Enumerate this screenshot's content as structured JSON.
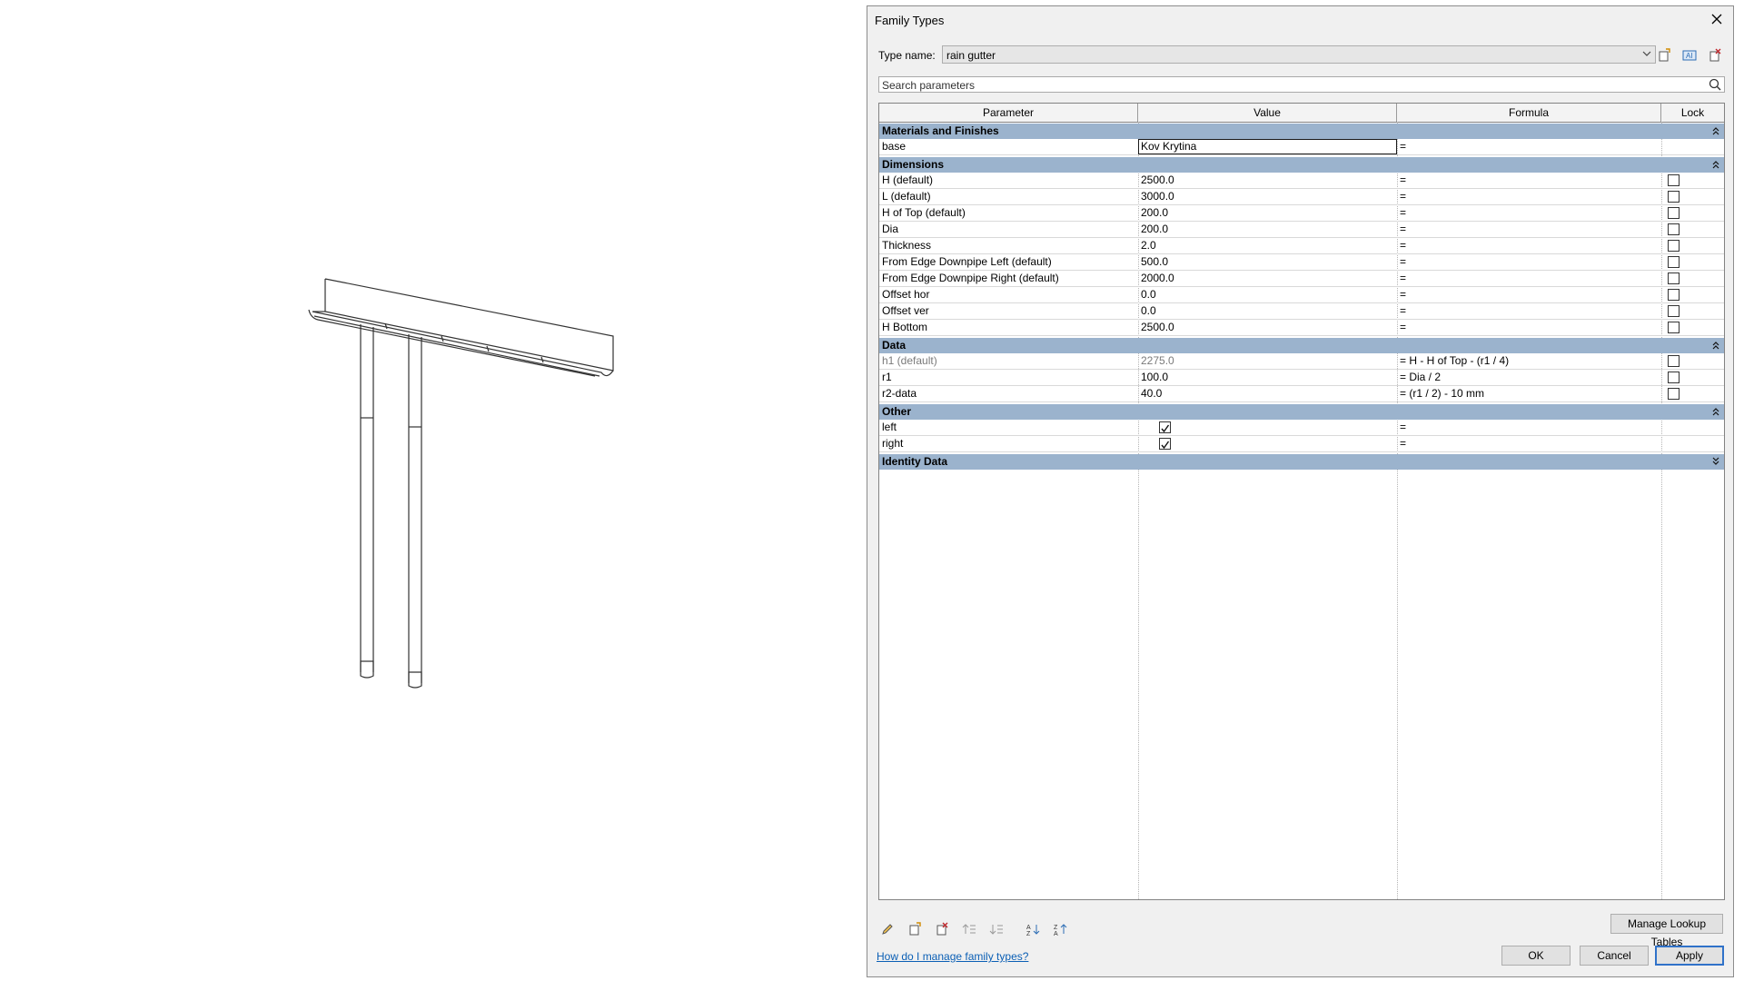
{
  "dialog": {
    "title": "Family Types",
    "type_name_label": "Type name:",
    "type_name_value": "rain gutter",
    "search_placeholder": "Search parameters",
    "help_link": "How do I manage family types?",
    "buttons": {
      "manage": "Manage Lookup Tables",
      "ok": "OK",
      "cancel": "Cancel",
      "apply": "Apply"
    }
  },
  "grid": {
    "columns": [
      "Parameter",
      "Value",
      "Formula",
      "Lock"
    ],
    "groups": [
      {
        "name": "Materials and Finishes",
        "icon": "collapse-icon",
        "rows": [
          {
            "param": "base",
            "value": "Kov Krytina",
            "formula": "=",
            "lock": null,
            "editing": true
          }
        ]
      },
      {
        "name": "Dimensions",
        "icon": "collapse-icon",
        "rows": [
          {
            "param": "H (default)",
            "value": "2500.0",
            "formula": "=",
            "lock": false
          },
          {
            "param": "L (default)",
            "value": "3000.0",
            "formula": "=",
            "lock": false
          },
          {
            "param": "H of Top (default)",
            "value": "200.0",
            "formula": "=",
            "lock": false
          },
          {
            "param": "Dia",
            "value": "200.0",
            "formula": "=",
            "lock": false
          },
          {
            "param": "Thickness",
            "value": "2.0",
            "formula": "=",
            "lock": false
          },
          {
            "param": "From Edge Downpipe Left (default)",
            "value": "500.0",
            "formula": "=",
            "lock": false
          },
          {
            "param": "From Edge Downpipe Right (default)",
            "value": "2000.0",
            "formula": "=",
            "lock": false
          },
          {
            "param": "Offset hor",
            "value": "0.0",
            "formula": "=",
            "lock": false
          },
          {
            "param": "Offset ver",
            "value": "0.0",
            "formula": "=",
            "lock": false
          },
          {
            "param": "H Bottom",
            "value": "2500.0",
            "formula": "=",
            "lock": false
          }
        ]
      },
      {
        "name": "Data",
        "icon": "collapse-icon",
        "rows": [
          {
            "param": "h1 (default)",
            "value": "2275.0",
            "formula": "= H - H of Top - (r1 / 4)",
            "lock": false,
            "gray": true
          },
          {
            "param": "r1",
            "value": "100.0",
            "formula": "= Dia / 2",
            "lock": false
          },
          {
            "param": "r2-data",
            "value": "40.0",
            "formula": "= (r1 / 2) - 10 mm",
            "lock": false
          }
        ]
      },
      {
        "name": "Other",
        "icon": "collapse-icon",
        "rows": [
          {
            "param": "left",
            "value": "",
            "checkbox_value": true,
            "formula": "=",
            "lock": null
          },
          {
            "param": "right",
            "value": "",
            "checkbox_value": true,
            "formula": "=",
            "lock": null
          }
        ]
      },
      {
        "name": "Identity Data",
        "icon": "expand-icon",
        "rows": []
      }
    ]
  },
  "toolbar_icons": [
    "pencil-icon",
    "new-parameter-icon",
    "delete-parameter-icon",
    "move-up-icon",
    "move-down-icon",
    "sort-ascending-icon",
    "sort-descending-icon"
  ],
  "colors": {
    "group_header": "#9bb3cd",
    "dialog_bg": "#f0f0f0",
    "link": "#0b5fb5",
    "default_border": "#3072c9"
  }
}
